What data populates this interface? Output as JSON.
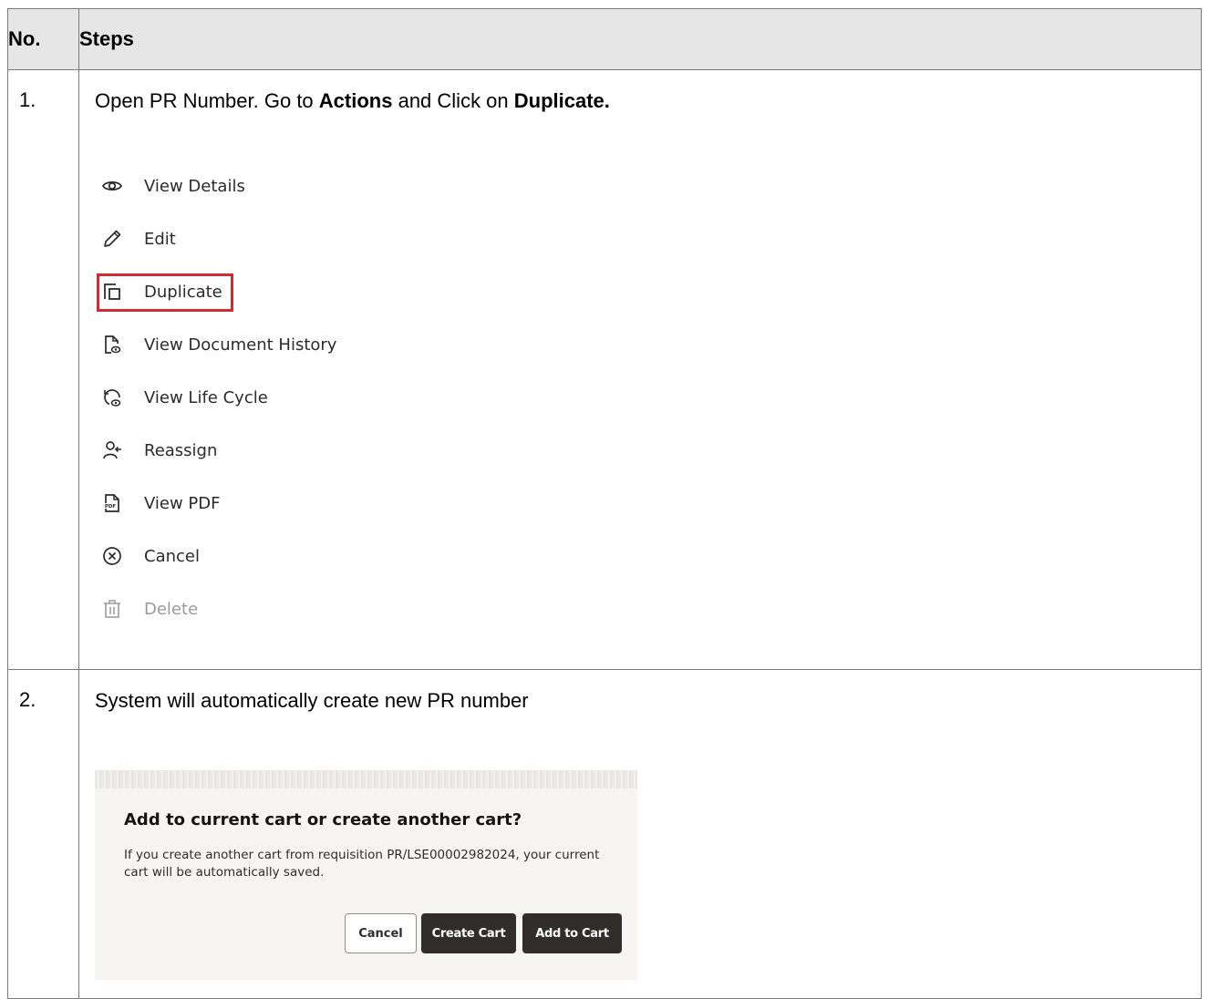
{
  "table": {
    "headers": {
      "no": "No.",
      "steps": "Steps"
    },
    "rows": [
      {
        "no": "1.",
        "text_parts": [
          "Open PR Number. Go to ",
          "Actions",
          " and Click on ",
          "Duplicate."
        ],
        "menu": [
          {
            "label": "View Details",
            "icon": "eye-icon"
          },
          {
            "label": "Edit",
            "icon": "pencil-icon"
          },
          {
            "label": "Duplicate",
            "icon": "duplicate-icon",
            "highlighted": true
          },
          {
            "label": "View Document History",
            "icon": "document-history-icon"
          },
          {
            "label": "View Life Cycle",
            "icon": "life-cycle-icon"
          },
          {
            "label": "Reassign",
            "icon": "reassign-user-icon"
          },
          {
            "label": "View PDF",
            "icon": "pdf-icon"
          },
          {
            "label": "Cancel",
            "icon": "cancel-circle-icon"
          },
          {
            "label": "Delete",
            "icon": "trash-icon",
            "disabled": true
          }
        ]
      },
      {
        "no": "2.",
        "text": "System will automatically create new PR number",
        "dialog": {
          "title": "Add to current cart or create another cart?",
          "message": "If you create another cart from requisition PR/LSE00002982024, your current cart will be automatically saved.",
          "buttons": {
            "cancel": "Cancel",
            "create": "Create Cart",
            "add": "Add to Cart"
          }
        }
      }
    ]
  },
  "colors": {
    "header_bg": "#e7e6e6",
    "highlight": "#cc2d32",
    "dialog_button": "#312d2a"
  }
}
